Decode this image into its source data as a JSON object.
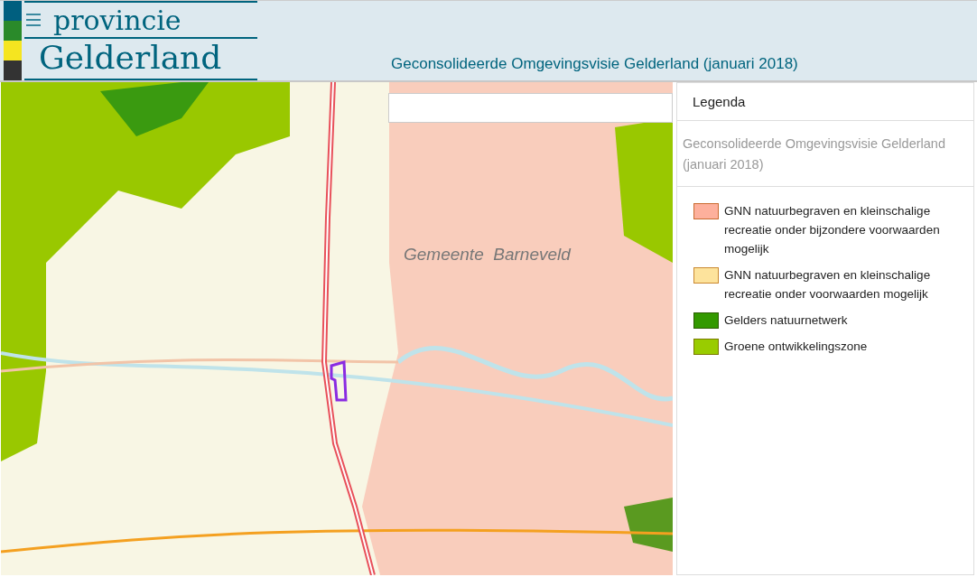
{
  "header": {
    "logo_top": "provincie",
    "logo_bottom": "Gelderland",
    "title": "Geconsolideerde Omgevingsvisie Gelderland (januari 2018)"
  },
  "map": {
    "place_label": "Gemeente  Barneveld"
  },
  "legend": {
    "title": "Legenda",
    "layer": "Geconsolideerde Omgevingsvisie Gelderland (januari 2018)",
    "items": [
      {
        "label": "GNN natuurbegraven en kleinschalige recreatie onder bijzondere voorwaarden mogelijk",
        "color": "#fdb09c"
      },
      {
        "label": "GNN natuurbegraven en kleinschalige recreatie onder voorwaarden mogelijk",
        "color": "#fde39c"
      },
      {
        "label": "Gelders natuurnetwerk",
        "color": "#339900"
      },
      {
        "label": "Groene ontwikkelingszone",
        "color": "#99cc00"
      }
    ]
  }
}
